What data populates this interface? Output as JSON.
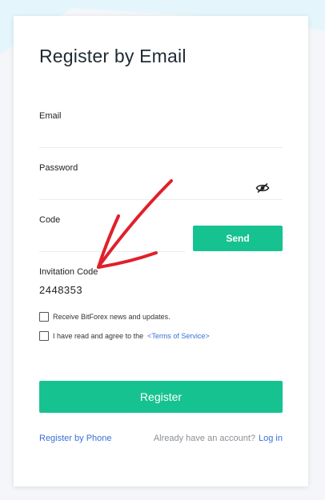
{
  "form": {
    "title": "Register by Email",
    "email": {
      "label": "Email",
      "value": ""
    },
    "password": {
      "label": "Password",
      "value": "",
      "icon": "eye-slash-icon"
    },
    "code": {
      "label": "Code",
      "value": "",
      "send_label": "Send"
    },
    "invitation": {
      "label": "Invitation Code",
      "value": "2448353"
    },
    "news_checkbox": {
      "label": "Receive BitForex news and updates.",
      "checked": false
    },
    "terms_checkbox": {
      "label": "I have read and agree to the",
      "link": "<Terms of Service>",
      "checked": false
    },
    "register_label": "Register",
    "phone_link": "Register by Phone",
    "account_prompt": "Already have an account?",
    "login_link": "Log in"
  },
  "colors": {
    "accent": "#17c291",
    "link": "#3a6fd8",
    "annotation_arrow": "#e0202a",
    "background": "#f4f6f9",
    "background_shape": "#e4f6fb"
  },
  "annotation": {
    "type": "hand-drawn arrow",
    "points_to": "Invitation Code"
  }
}
